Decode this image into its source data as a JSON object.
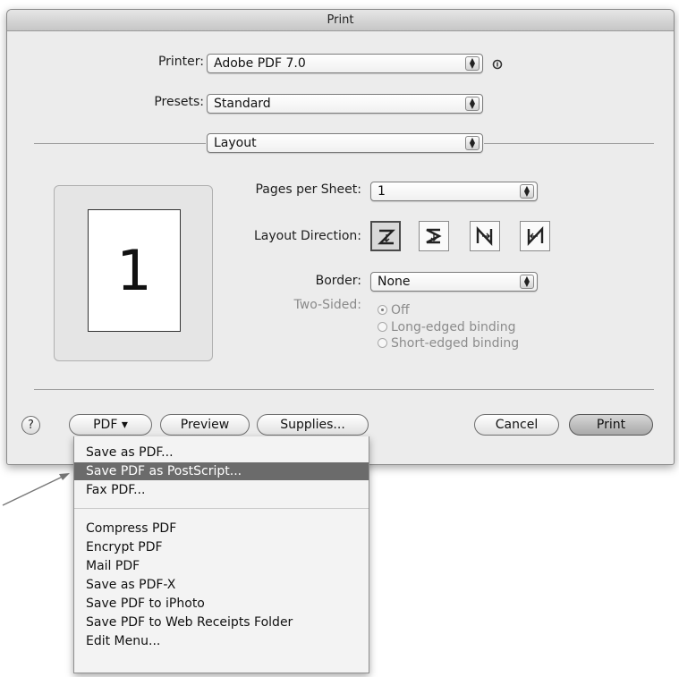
{
  "dialog": {
    "title": "Print"
  },
  "printer": {
    "label": "Printer:",
    "value": "Adobe PDF 7.0",
    "info_icon": "info-circle-icon"
  },
  "presets": {
    "label": "Presets:",
    "value": "Standard"
  },
  "pane": {
    "value": "Layout"
  },
  "layout": {
    "pages_per_sheet_label": "Pages per Sheet:",
    "pages_per_sheet_value": "1",
    "direction_label": "Layout Direction:",
    "directions": [
      "z-right-down-icon",
      "s-left-down-icon",
      "n-down-right-icon",
      "reverse-n-down-left-icon"
    ],
    "selected_direction": 0,
    "border_label": "Border:",
    "border_value": "None",
    "two_sided_label": "Two-Sided:",
    "two_sided_options": [
      "Off",
      "Long-edged binding",
      "Short-edged binding"
    ],
    "two_sided_selected": "Off",
    "preview_page_number": "1"
  },
  "buttons": {
    "help": "?",
    "pdf": "PDF ▾",
    "preview": "Preview",
    "supplies": "Supplies...",
    "cancel": "Cancel",
    "print": "Print"
  },
  "pdf_menu": {
    "items": [
      "Save as PDF...",
      "Save PDF as PostScript...",
      "Fax PDF...",
      "Compress PDF",
      "Encrypt PDF",
      "Mail PDF",
      "Save as PDF-X",
      "Save PDF to iPhoto",
      "Save PDF to Web Receipts Folder",
      "Edit Menu..."
    ],
    "highlighted_index": 1
  },
  "colors": {
    "dialog_bg": "#ececec",
    "menu_highlight": "#6b6b6b"
  }
}
